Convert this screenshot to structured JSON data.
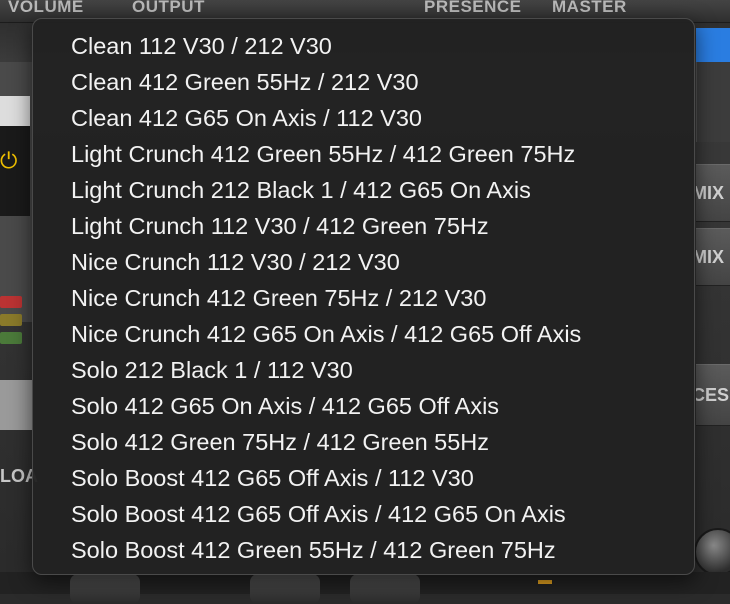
{
  "background": {
    "top_labels": {
      "volume": "VOLUME",
      "output": "OUTPUT",
      "presence": "PRESENCE",
      "master": "MASTER"
    },
    "right_tabs": [
      "MIX",
      "MIX",
      "CES"
    ],
    "left_label": "LOA",
    "power_icon": "power-icon",
    "accent_color": "#2a7de1"
  },
  "menu": {
    "items": [
      "Clean 112 V30 / 212 V30",
      "Clean 412 Green 55Hz / 212 V30",
      "Clean 412 G65 On Axis / 112 V30",
      "Light Crunch 412 Green 55Hz / 412 Green 75Hz",
      "Light Crunch 212 Black 1 / 412 G65 On Axis",
      "Light Crunch 112 V30 / 412 Green 75Hz",
      "Nice Crunch 112 V30 / 212 V30",
      "Nice Crunch 412 Green 75Hz / 212 V30",
      "Nice Crunch 412 G65 On Axis / 412 G65 Off Axis",
      "Solo 212 Black 1 / 112 V30",
      "Solo 412 G65 On Axis / 412 G65 Off Axis",
      "Solo 412 Green 75Hz / 412 Green 55Hz",
      "Solo Boost 412 G65 Off Axis / 112 V30",
      "Solo Boost 412 G65 Off Axis / 412 G65 On Axis",
      "Solo Boost 412 Green 55Hz / 412 Green 75Hz"
    ]
  }
}
